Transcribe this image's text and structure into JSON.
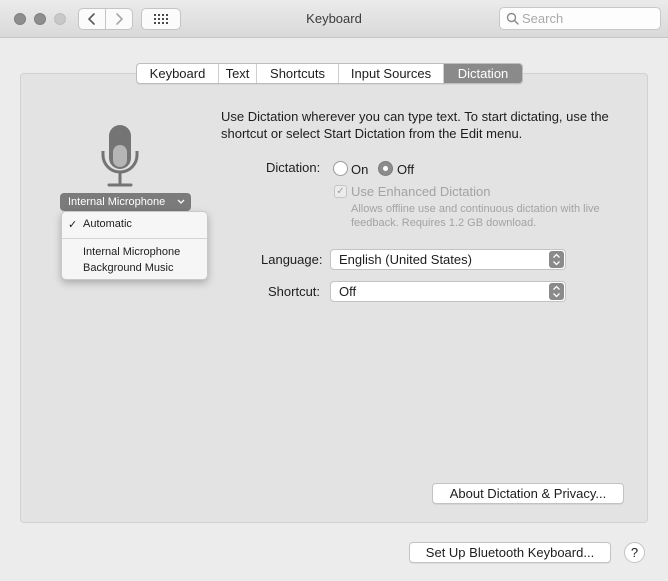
{
  "window": {
    "title": "Keyboard",
    "search_placeholder": "Search"
  },
  "tabs": [
    {
      "label": "Keyboard"
    },
    {
      "label": "Text"
    },
    {
      "label": "Shortcuts"
    },
    {
      "label": "Input Sources"
    },
    {
      "label": "Dictation",
      "selected": true
    }
  ],
  "mic": {
    "source_label": "Internal Microphone",
    "menu": {
      "checked_item": "Automatic",
      "items": [
        "Internal Microphone",
        "Background Music"
      ]
    }
  },
  "dictation": {
    "intro": "Use Dictation wherever you can type text. To start dictating, use the shortcut or select Start Dictation from the Edit menu.",
    "label": "Dictation:",
    "on_label": "On",
    "off_label": "Off",
    "selected": "Off",
    "enhanced_label": "Use Enhanced Dictation",
    "enhanced_checked": true,
    "enhanced_desc": "Allows offline use and continuous dictation with live feedback. Requires 1.2 GB download."
  },
  "language": {
    "label": "Language:",
    "value": "English (United States)"
  },
  "shortcut": {
    "label": "Shortcut:",
    "value": "Off"
  },
  "buttons": {
    "about": "About Dictation & Privacy...",
    "bluetooth": "Set Up Bluetooth Keyboard...",
    "help": "?"
  },
  "icons": {
    "back": "chevron-left-icon",
    "forward": "chevron-right-icon",
    "grid": "grid-icon",
    "search": "search-icon",
    "mic": "microphone-icon"
  }
}
